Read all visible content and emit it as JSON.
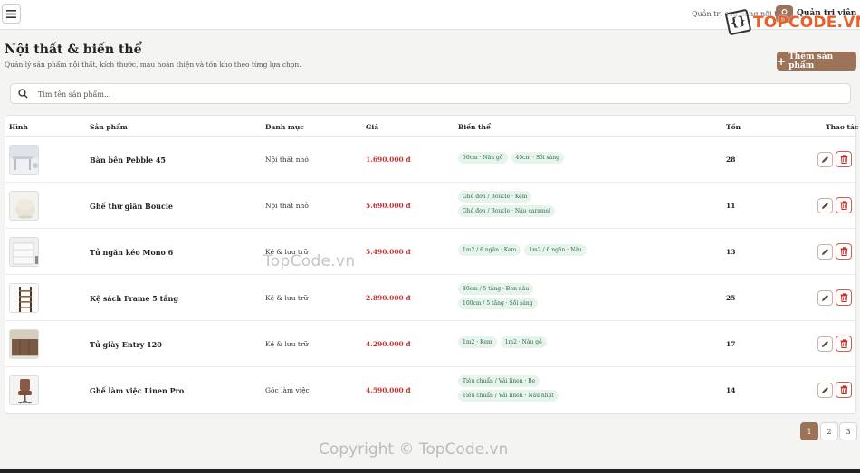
{
  "header": {
    "breadcrumb": "Quản trị cửa hàng nội thất",
    "admin_label": "Quản trị viên",
    "watermark_logo": "TOPCODE.VN"
  },
  "page": {
    "title": "Nội thất & biến thể",
    "subtitle": "Quản lý sản phẩm nội thất, kích thước, màu hoàn thiện và tồn kho theo từng lựa chọn.",
    "add_button": "Thêm sản phẩm"
  },
  "search": {
    "placeholder": "Tìm tên sản phẩm...",
    "value": ""
  },
  "table": {
    "headers": [
      "Hình",
      "Sản phẩm",
      "Danh mục",
      "Giá",
      "Biến thể",
      "Tồn",
      "Thao tác"
    ],
    "rows": [
      {
        "name": "Bàn bên Pebble 45",
        "category": "Nội thất nhỏ",
        "price": "1.690.000 đ",
        "stock": "28",
        "variants": [
          [
            "50cm · Nâu gỗ",
            "45cm · Sồi sáng"
          ]
        ]
      },
      {
        "name": "Ghế thư giãn Boucle",
        "category": "Nội thất nhỏ",
        "price": "5.690.000 đ",
        "stock": "11",
        "variants": [
          [
            "Ghế đơn / Boucle · Kem"
          ],
          [
            "Ghế đơn / Boucle · Nâu caramel"
          ]
        ]
      },
      {
        "name": "Tủ ngăn kéo Mono 6",
        "category": "Kệ & lưu trữ",
        "price": "5.490.000 đ",
        "stock": "13",
        "variants": [
          [
            "1m2 / 6 ngăn · Kem",
            "1m2 / 6 ngăn · Nâu"
          ]
        ]
      },
      {
        "name": "Kệ sách Frame 5 tầng",
        "category": "Kệ & lưu trữ",
        "price": "2.890.000 đ",
        "stock": "25",
        "variants": [
          [
            "80cm / 5 tầng · Đen nâu"
          ],
          [
            "100cm / 5 tầng · Sồi sáng"
          ]
        ]
      },
      {
        "name": "Tủ giày Entry 120",
        "category": "Kệ & lưu trữ",
        "price": "4.290.000 đ",
        "stock": "17",
        "variants": [
          [
            "1m2 · Kem",
            "1m2 · Nâu gỗ"
          ]
        ]
      },
      {
        "name": "Ghế làm việc Linen Pro",
        "category": "Góc làm việc",
        "price": "4.590.000 đ",
        "stock": "14",
        "variants": [
          [
            "Tiêu chuẩn / Vải linen · Be"
          ],
          [
            "Tiêu chuẩn / Vải linen · Nâu nhạt"
          ]
        ]
      }
    ]
  },
  "pagination": {
    "pages": [
      "1",
      "2",
      "3"
    ],
    "active": "1"
  },
  "watermarks": {
    "middle": "TopCode.vn",
    "bottom": "Copyright © TopCode.vn"
  },
  "colors": {
    "accent": "#9b7358",
    "price": "#c9302c",
    "tag_bg": "#e6f4ec",
    "tag_text": "#2e6b4a",
    "delete": "#d45a55"
  },
  "icons": {
    "menu": "hamburger-icon",
    "search": "search-icon",
    "user": "user-icon",
    "edit": "pencil-icon",
    "delete": "trash-icon",
    "chevron": "chevron-down-icon"
  }
}
